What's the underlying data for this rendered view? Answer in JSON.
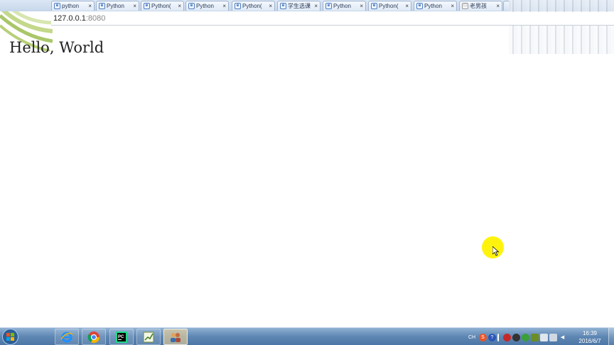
{
  "browser": {
    "tabs": [
      {
        "title": "python"
      },
      {
        "title": "Python"
      },
      {
        "title": "Python("
      },
      {
        "title": "Python"
      },
      {
        "title": "Python("
      },
      {
        "title": "学生选课"
      },
      {
        "title": "Python"
      },
      {
        "title": "Python("
      },
      {
        "title": "Python"
      },
      {
        "title": "老男孩"
      }
    ],
    "tab_close_glyph": "×",
    "address": {
      "host": "127.0.0.1",
      "port": ":8080"
    }
  },
  "page": {
    "body_text": "Hello, World"
  },
  "taskbar": {
    "pinned": [
      {
        "icon": "internet-explorer-icon"
      },
      {
        "icon": "chrome-icon"
      },
      {
        "icon": "pycharm-icon"
      },
      {
        "icon": "chart-app-icon"
      },
      {
        "icon": "users-app-icon"
      }
    ],
    "tray": {
      "lang": "CH",
      "sogou": "S",
      "help": "?"
    },
    "clock": {
      "time": "16:39",
      "date": "2016/6/7"
    }
  },
  "colors": {
    "taskbar": "#5f87b3",
    "cursor_highlight": "#fff200",
    "tab_bg": "#dfe9f6"
  }
}
